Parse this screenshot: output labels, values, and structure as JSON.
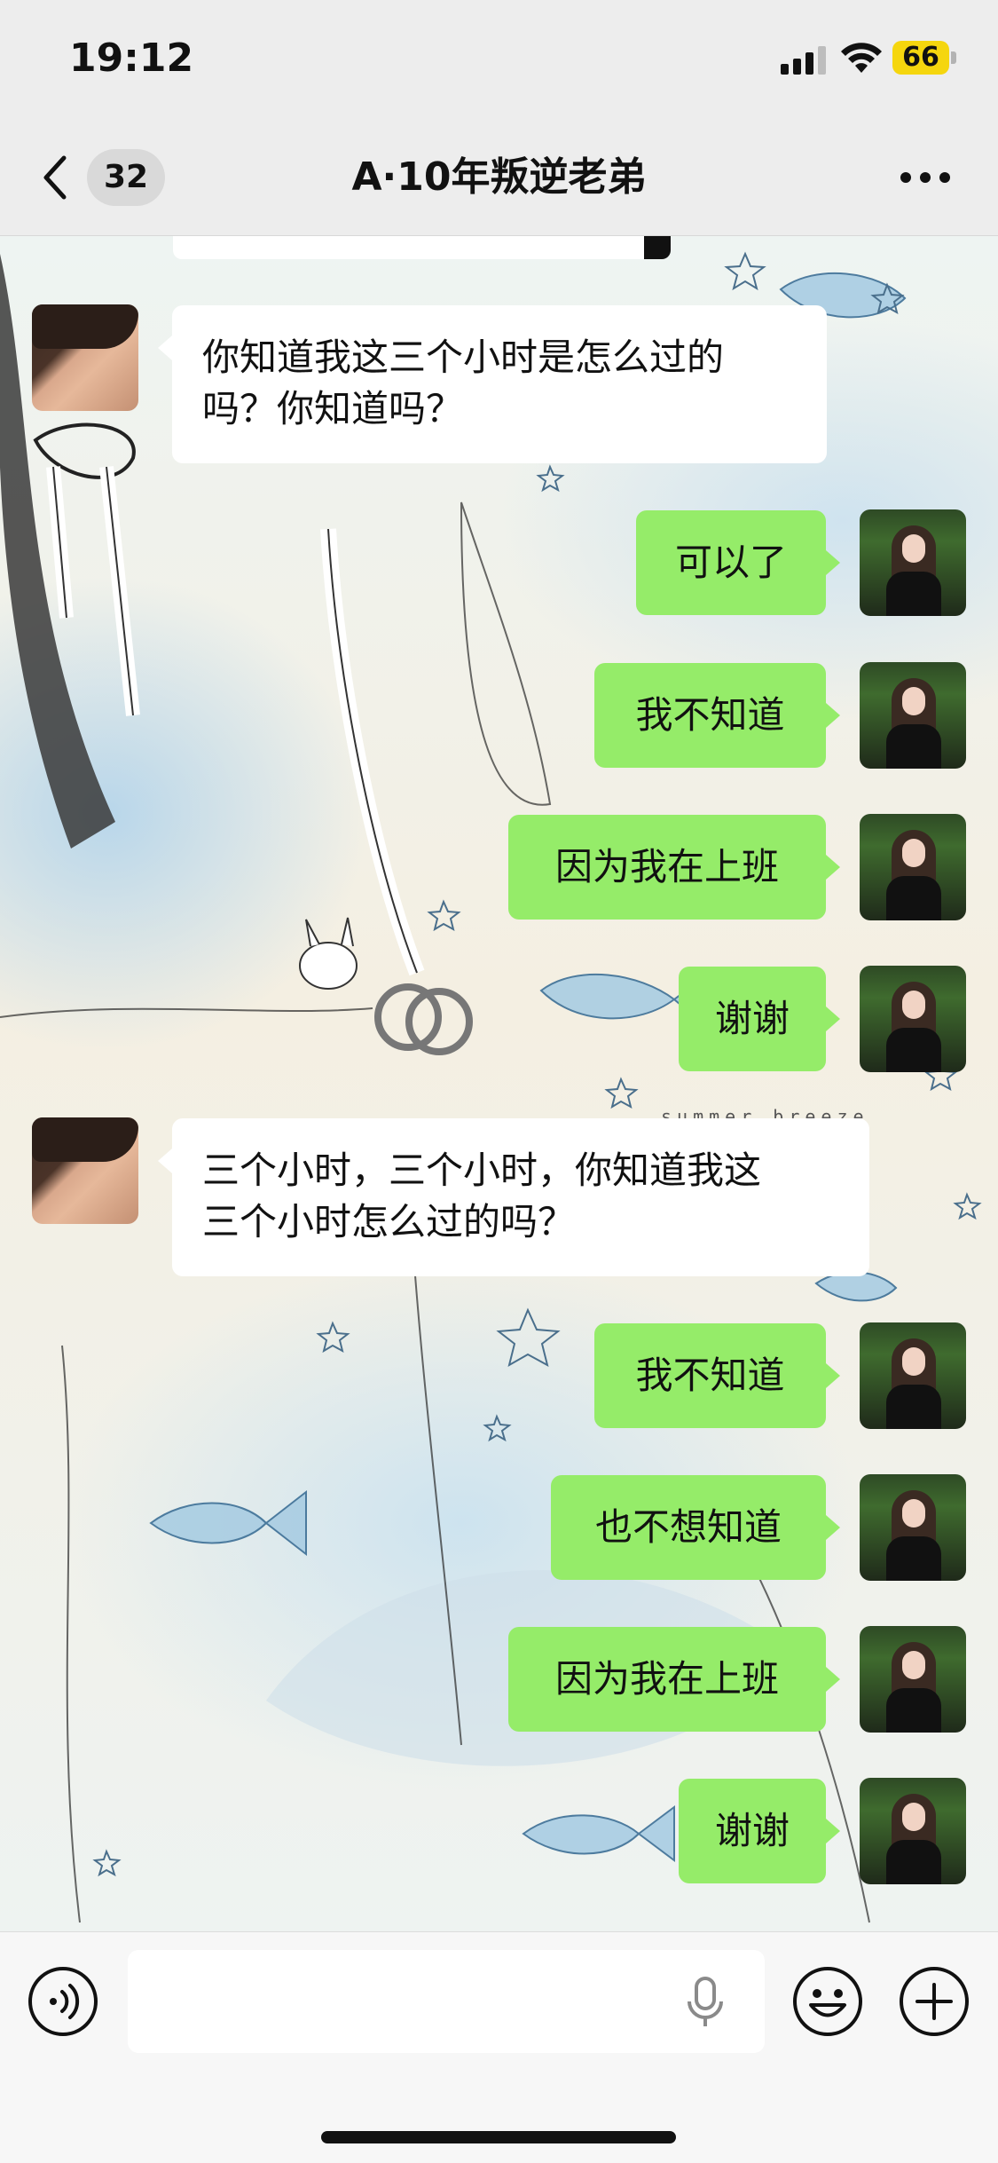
{
  "status_bar": {
    "time": "19:12",
    "battery": "66",
    "icons": [
      "cellular-signal-icon",
      "wifi-icon",
      "battery-icon"
    ],
    "battery_color": "#f5d60e"
  },
  "header": {
    "back_icon": "chevron-left-icon",
    "unread_count": "32",
    "title": "A·10年叛逆老弟",
    "more_icon": "more-dots-icon"
  },
  "messages": [
    {
      "side": "left",
      "text": [
        "你知道我这三个小时是怎么过的",
        "吗？你知道吗？"
      ]
    },
    {
      "side": "right",
      "text": [
        "可以了"
      ]
    },
    {
      "side": "right",
      "text": [
        "我不知道"
      ]
    },
    {
      "side": "right",
      "text": [
        "因为我在上班"
      ]
    },
    {
      "side": "right",
      "text": [
        "谢谢"
      ]
    },
    {
      "side": "left",
      "text": [
        "三个小时，三个小时，你知道我这",
        "三个小时怎么过的吗？"
      ]
    },
    {
      "side": "right",
      "text": [
        "我不知道"
      ]
    },
    {
      "side": "right",
      "text": [
        "也不想知道"
      ]
    },
    {
      "side": "right",
      "text": [
        "因为我在上班"
      ]
    },
    {
      "side": "right",
      "text": [
        "谢谢"
      ]
    }
  ],
  "background_text": "summer breeze",
  "input_bar": {
    "voice_icon": "voice-input-icon",
    "mic_icon": "microphone-icon",
    "emoji_icon": "emoji-icon",
    "plus_icon": "plus-icon",
    "value": ""
  },
  "colors": {
    "sent_bubble": "#95ec69",
    "received_bubble": "#ffffff",
    "bar_bg": "#ededed"
  }
}
